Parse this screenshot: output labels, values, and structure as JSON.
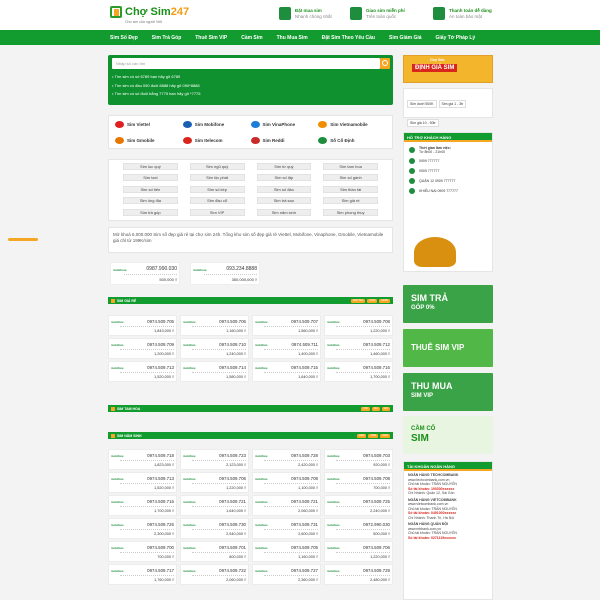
{
  "header": {
    "logo": "Chợ Sim",
    "logo_num": "247",
    "logo_sub": "Chợ sim của người Việt",
    "features": [
      {
        "title": "Đặt mua sim",
        "sub": "Nhanh chóng nhất"
      },
      {
        "title": "Giao sim miễn phí",
        "sub": "Trên toàn quốc"
      },
      {
        "title": "Thanh toán dễ dàng",
        "sub": "An toàn bảo mật"
      }
    ]
  },
  "nav": [
    "Sim Số Đẹp",
    "Sim Trả Góp",
    "Thuê Sim VIP",
    "Cầm Sim",
    "Thu Mua Sim",
    "Đặt Sim Theo Yêu Cầu",
    "Sim Giảm Giá",
    "Giấy Tờ Pháp Lý"
  ],
  "search": {
    "placeholder": "Nhập số cần tìm",
    "tips": [
      "Tìm sim có số 6789 bạn hãy gõ 6789",
      "Tìm sim có đầu 090 đuôi 8888 hãy gõ 090*8888",
      "Tìm sim có số đuôi bằng 7775 bạn hãy gõ *7775"
    ]
  },
  "networks": [
    "Sim Viettel",
    "Sim Mobifone",
    "Sim VinaPhone",
    "Sim Vietnamobile",
    "Sim Gmobile",
    "Sim Itelecom",
    "Sim Reddi",
    "Số Cố Định"
  ],
  "network_colors": [
    "#e02020",
    "#1a5fb4",
    "#1c7ed6",
    "#f08c00",
    "#e67700",
    "#d9261c",
    "#c92a2a",
    "#1e8e3e"
  ],
  "categories": [
    "Sim lục quý",
    "Sim ngũ quý",
    "Sim tứ quý",
    "Sim tam hoa",
    "Sim taxi",
    "Sim lộc phát",
    "Sim số lặp",
    "Sim số gánh",
    "Sim số tiến",
    "Sim số kép",
    "Sim số đảo",
    "Sim thần tài",
    "Sim ông địa",
    "Sim đầu cổ",
    "Sim trả sau",
    "Sim giá rẻ",
    "Sim trả góp",
    "Sim VIP",
    "Sim năm sinh",
    "Sim phong thuỷ"
  ],
  "description": "Mở khoá 6.000.000 Sim số đẹp giá rẻ tại chợ sim 24h. Tổng kho sim số đẹp giá rẻ Viettel, Mobifone, Vinaphone, Gmobile, Vietnamobile giá chỉ từ 199K/sim",
  "featured": [
    {
      "number": "0987.990.030",
      "price": "500,000 ₫"
    },
    {
      "number": "093.234.8888",
      "price": "350,000,000 ₫"
    }
  ],
  "sections": [
    {
      "title": "SIM GIÁ RẺ",
      "tags": [
        "VIETTEL",
        "VINA",
        "MOBI"
      ]
    },
    {
      "title": "SIM TAM HOA",
      "tags": [
        "000",
        "111",
        "222"
      ]
    },
    {
      "title": "SIM NĂM SINH",
      "tags": [
        "1990",
        "1991",
        "1992"
      ]
    }
  ],
  "provider_label": "mobifone",
  "sims_cheap": [
    {
      "number": "0974.509.705",
      "price": "1,843,000 ₫"
    },
    {
      "number": "0974.509.706",
      "price": "1,160,000 ₫"
    },
    {
      "number": "0974.509.707",
      "price": "1,560,000 ₫"
    },
    {
      "number": "0974.509.708",
      "price": "1,220,000 ₫"
    },
    {
      "number": "0974.509.709",
      "price": "1,200,000 ₫"
    },
    {
      "number": "0974.509.710",
      "price": "1,240,000 ₫"
    },
    {
      "number": "0974.509.711",
      "price": "1,400,000 ₫"
    },
    {
      "number": "0974.509.712",
      "price": "1,460,000 ₫"
    },
    {
      "number": "0974.509.713",
      "price": "1,520,000 ₫"
    },
    {
      "number": "0974.509.714",
      "price": "1,580,000 ₫"
    },
    {
      "number": "0974.509.715",
      "price": "1,640,000 ₫"
    },
    {
      "number": "0974.509.716",
      "price": "1,700,000 ₫"
    }
  ],
  "sims_year": [
    {
      "number": "0974.509.718",
      "price": "1,823,000 ₫"
    },
    {
      "number": "0974.509.723",
      "price": "2,123,000 ₫"
    },
    {
      "number": "0974.509.728",
      "price": "2,420,000 ₫"
    },
    {
      "number": "0974.509.703",
      "price": "920,000 ₫"
    },
    {
      "number": "0974.509.713",
      "price": "1,520,000 ₫"
    },
    {
      "number": "0974.509.706",
      "price": "1,220,000 ₫"
    },
    {
      "number": "0974.509.708",
      "price": "1,100,000 ₫"
    },
    {
      "number": "0974.509.708",
      "price": "700,000 ₫"
    },
    {
      "number": "0974.509.716",
      "price": "1,700,000 ₫"
    },
    {
      "number": "0974.509.721",
      "price": "1,640,000 ₫"
    },
    {
      "number": "0974.509.721",
      "price": "2,060,000 ₫"
    },
    {
      "number": "0974.509.725",
      "price": "2,240,000 ₫"
    },
    {
      "number": "0974.509.726",
      "price": "2,300,000 ₫"
    },
    {
      "number": "0974.509.730",
      "price": "2,540,000 ₫"
    },
    {
      "number": "0974.509.731",
      "price": "2,600,000 ₫"
    },
    {
      "number": "0972.990.030",
      "price": "500,000 ₫"
    },
    {
      "number": "0974.509.700",
      "price": "700,000 ₫"
    },
    {
      "number": "0974.509.701",
      "price": "800,000 ₫"
    },
    {
      "number": "0974.509.705",
      "price": "1,160,000 ₫"
    },
    {
      "number": "0974.509.706",
      "price": "1,220,000 ₫"
    },
    {
      "number": "0974.509.717",
      "price": "1,760,000 ₫"
    },
    {
      "number": "0974.509.722",
      "price": "2,060,000 ₫"
    },
    {
      "number": "0974.509.727",
      "price": "2,360,000 ₫"
    },
    {
      "number": "0974.509.729",
      "price": "2,480,000 ₫"
    }
  ],
  "sidebar": {
    "banner_title": "ĐỊNH GIÁ SIM",
    "banner_sub": "Chợ Sim",
    "price_filters": [
      "Sim dưới 500K",
      "Sim giá 1 - 3tr",
      "Sim giá 10 - 50tr"
    ],
    "support_title": "HỖ TRỢ KHÁCH HÀNG",
    "support_hours_title": "Thời gian làm việc:",
    "support_hours": "Từ 8h00 - 21h00",
    "support_lines": [
      "0909 777777",
      "0909 777777",
      "QUẬN 12 0909 777777",
      "KHIẾU NẠI 0909 777777"
    ],
    "promos": [
      {
        "t1": "SIM TRẢ",
        "t2": "GÓP 0%",
        "color": "#3aa348"
      },
      {
        "t1": "THUÊ SIM VIP",
        "t2": "",
        "color": "#51b847"
      },
      {
        "t1": "THU MUA",
        "t2": "SIM VIP",
        "color": "#3aa348"
      },
      {
        "t1": "CẦM CỐ",
        "t2": "SIM",
        "color": "#e8f5e0"
      }
    ],
    "bank_title": "TÀI KHOẢN NGÂN HÀNG",
    "banks": [
      {
        "name": "NGÂN HÀNG TECHCOMBANK",
        "site": "www.techcombank.com.vn",
        "holder": "Chủ tài khoản: TRẦN NGUYỄN",
        "acc": "Số tài khoản: 190300xxxxxx",
        "branch": "Chi Nhánh: Quận 12, Sài Gòn"
      },
      {
        "name": "NGÂN HÀNG VIETCOMBANK",
        "site": "www.vietcombank.com.vn",
        "holder": "Chủ tài khoản: TRẦN NGUYỄN",
        "acc": "Số tài khoản: 0491000xxxxxx",
        "branch": "Chi Nhánh: Thanh Trì, Hà Nội"
      },
      {
        "name": "NGÂN HÀNG QUÂN ĐỘI",
        "site": "www.mbbank.com.vn",
        "holder": "Chủ tài khoản: TRẦN NGUYỄN",
        "acc": "Số tài khoản: 0271119xxxxxx",
        "branch": ""
      }
    ]
  }
}
